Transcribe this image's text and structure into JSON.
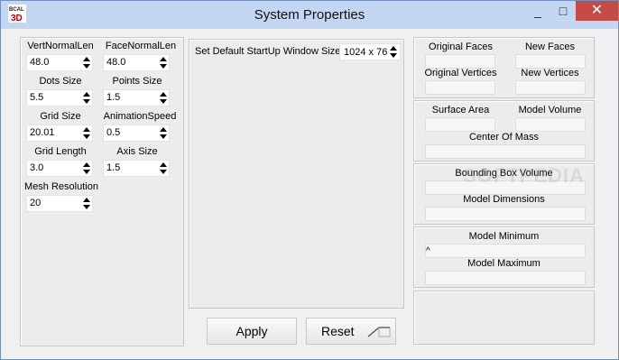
{
  "window": {
    "title": "System Properties",
    "minimize": "_",
    "maximize": "□",
    "close": "✕",
    "app_icon": "bcal-3d-logo",
    "app_icon_text": "BCAL 3D"
  },
  "left_panel": {
    "vert_normal_len": {
      "label": "VertNormalLen",
      "value": "48.0"
    },
    "face_normal_len": {
      "label": "FaceNormalLen",
      "value": "48.0"
    },
    "dots_size": {
      "label": "Dots Size",
      "value": "5.5"
    },
    "points_size": {
      "label": "Points Size",
      "value": "1.5"
    },
    "grid_size": {
      "label": "Grid Size",
      "value": "20.01"
    },
    "animation_speed": {
      "label": "AnimationSpeed",
      "value": "0.5"
    },
    "grid_length": {
      "label": "Grid Length",
      "value": "3.0"
    },
    "axis_size": {
      "label": "Axis Size",
      "value": "1.5"
    },
    "mesh_resolution": {
      "label": "Mesh Resolution",
      "value": "20"
    }
  },
  "middle_panel": {
    "startup_label": "Set Default StartUp Window Size",
    "startup_value": "1024 x 76"
  },
  "buttons": {
    "apply": "Apply",
    "reset": "Reset"
  },
  "right_panel": {
    "original_faces": "Original Faces",
    "new_faces": "New Faces",
    "original_vertices": "Original Vertices",
    "new_vertices": "New Vertices",
    "surface_area": "Surface Area",
    "model_volume": "Model Volume",
    "center_of_mass": "Center Of Mass",
    "bounding_box_volume": "Bounding Box Volume",
    "model_dimensions": "Model Dimensions",
    "model_minimum": "Model Minimum",
    "model_minimum_value": "^",
    "model_maximum": "Model Maximum"
  },
  "watermark": {
    "text": "SOFTPEDIA"
  },
  "colors": {
    "titlebar": "#c3d6f2",
    "close_button": "#c74b45",
    "panel": "#ececec"
  }
}
